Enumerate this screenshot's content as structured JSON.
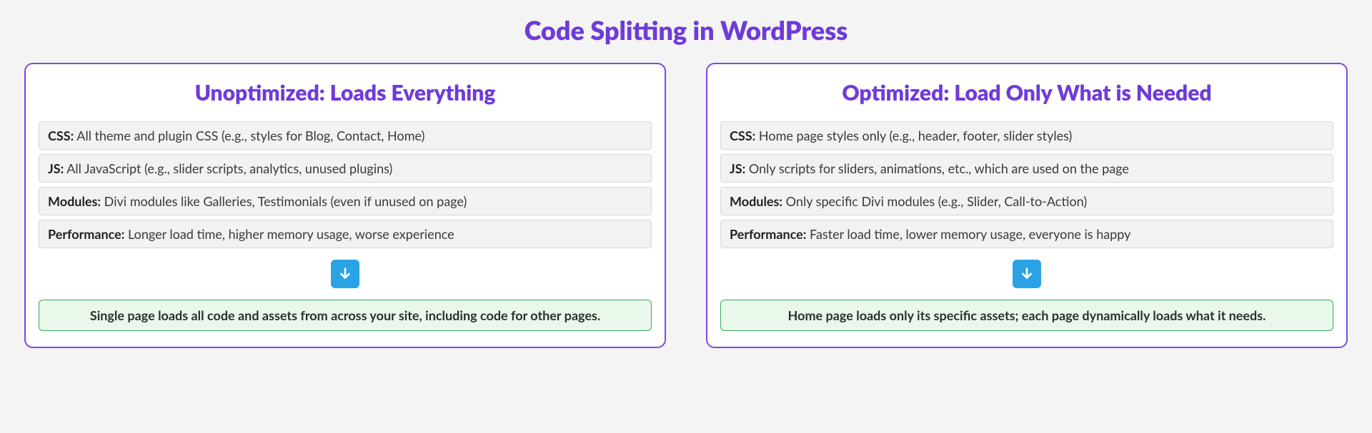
{
  "title": "Code Splitting in WordPress",
  "panels": [
    {
      "title": "Unoptimized: Loads Everything",
      "items": [
        {
          "label": "CSS:",
          "text": " All theme and plugin CSS (e.g., styles for Blog, Contact, Home)"
        },
        {
          "label": "JS:",
          "text": " All JavaScript (e.g., slider scripts, analytics, unused plugins)"
        },
        {
          "label": "Modules:",
          "text": " Divi modules like Galleries, Testimonials (even if unused on page)"
        },
        {
          "label": "Performance:",
          "text": " Longer load time, higher memory usage, worse experience"
        }
      ],
      "summary": "Single page loads all code and assets from across your site, including code for other pages."
    },
    {
      "title": "Optimized: Load Only What is Needed",
      "items": [
        {
          "label": "CSS:",
          "text": " Home page styles only (e.g., header, footer, slider styles)"
        },
        {
          "label": "JS:",
          "text": " Only scripts for sliders, animations, etc., which are used on the page"
        },
        {
          "label": "Modules:",
          "text": " Only specific Divi modules (e.g., Slider, Call-to-Action)"
        },
        {
          "label": "Performance:",
          "text": " Faster load time, lower memory usage, everyone is happy"
        }
      ],
      "summary": "Home page loads only its specific assets; each page dynamically loads what it needs."
    }
  ]
}
